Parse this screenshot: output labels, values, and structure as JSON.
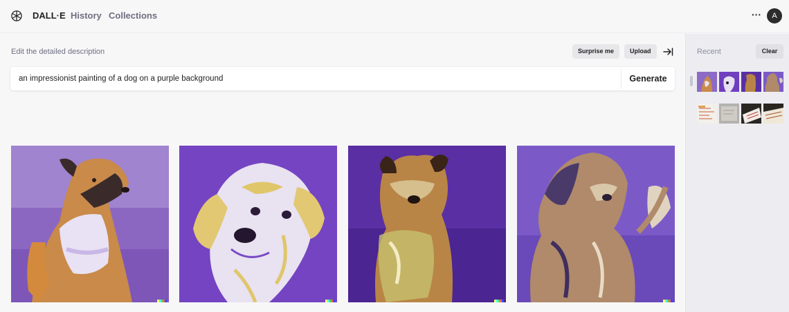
{
  "header": {
    "brand": "DALL·E",
    "nav": [
      "History",
      "Collections"
    ],
    "more_glyph": "···",
    "avatar_initial": "A",
    "icons": {
      "logo": "openai-logo-icon",
      "more": "more-dots-icon"
    }
  },
  "editor": {
    "description_label": "Edit the detailed description",
    "surprise_label": "Surprise me",
    "upload_label": "Upload",
    "collapse_icon": "collapse-sidebar-icon",
    "prompt_value": "an impressionist painting of a dog on a purple background",
    "generate_label": "Generate"
  },
  "results": [
    {
      "alt": "impressionist dog, orange and white, on purple"
    },
    {
      "alt": "impressionist white dog with floppy ears, on purple"
    },
    {
      "alt": "impressionist dog looking up, on purple"
    },
    {
      "alt": "impressionist scruffy dog, on purple"
    }
  ],
  "signature_colors": [
    "#ffff66",
    "#42ffff",
    "#51da4c",
    "#ff6e3c",
    "#3c46ff"
  ],
  "sidebar": {
    "recent_label": "Recent",
    "clear_label": "Clear",
    "thumb_rows": 2,
    "thumbs_per_row": 4
  },
  "colors": {
    "purple_bg": "#6b3fb3",
    "light_purple": "#a489cf",
    "accent_text": "#202123"
  }
}
